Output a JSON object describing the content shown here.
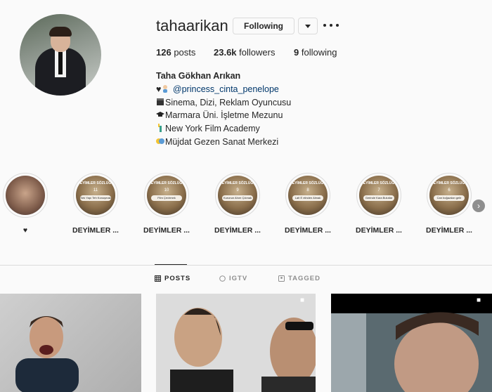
{
  "profile": {
    "username": "tahaarikan",
    "follow_label": "Following",
    "stats": {
      "posts_count": "126",
      "posts_label": "posts",
      "followers_count": "23.6k",
      "followers_label": "followers",
      "following_count": "9",
      "following_label": "following"
    },
    "bio": {
      "full_name": "Taha Gökhan Arıkan",
      "line1_prefix": "♥",
      "mention": "@princess_cinta_penelope",
      "line2": "Sinema, Dizi, Reklam Oyuncusu",
      "line3": "Marmara Üni. İşletme Mezunu",
      "line4": "New York Film Academy",
      "line5": "Müjdat Gezen Sanat Merkezi"
    }
  },
  "highlights": [
    {
      "label": "♥",
      "cover": "face"
    },
    {
      "label": "DEYİMLER ...",
      "num": "11",
      "text": "Sek Yapı Teh Konuşmak"
    },
    {
      "label": "DEYİMLER ...",
      "num": "10",
      "text": "Film Çevirmek"
    },
    {
      "label": "DEYİMLER ...",
      "num": "9",
      "text": "Kurunun Ahım Çıkmak"
    },
    {
      "label": "DEYİMLER ...",
      "num": "8",
      "text": "Lafı E elinden Almak"
    },
    {
      "label": "DEYİMLER ...",
      "num": "7",
      "text": "Gerinde Kara Bulutlar"
    },
    {
      "label": "DEYİMLER ...",
      "num": "6",
      "text": "Can boğazdan gelir"
    }
  ],
  "highlight_cover_title": "DEYİMLER SÖZLÜĞÜ",
  "tabs": [
    {
      "label": "POSTS",
      "active": true
    },
    {
      "label": "IGTV",
      "active": false
    },
    {
      "label": "TAGGED",
      "active": false
    }
  ],
  "colors": {
    "background": "#fafafa",
    "text": "#262626",
    "muted": "#8e8e8e",
    "border": "#dbdbdb",
    "mention": "#00376b"
  }
}
